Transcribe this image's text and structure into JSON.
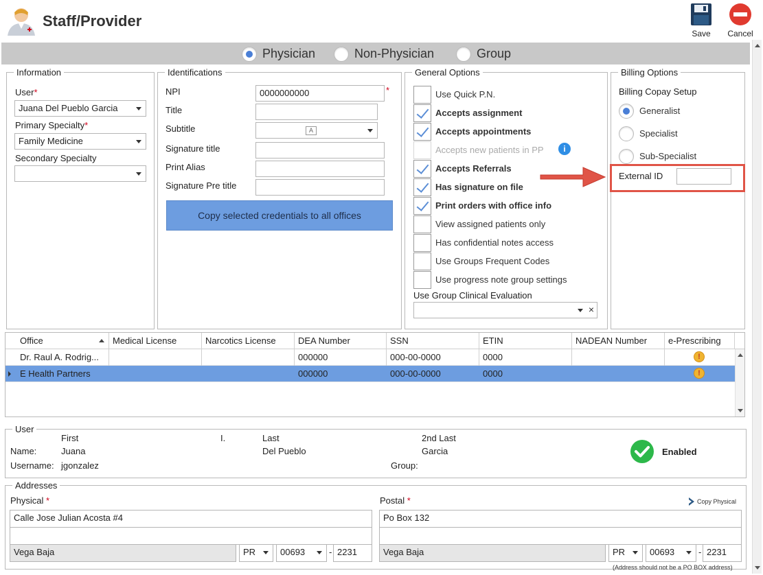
{
  "window": {
    "title": "Staff/Provider",
    "save_label": "Save",
    "cancel_label": "Cancel",
    "colors": {
      "accent": "#4a7fd6",
      "selected_row": "#6d9de0",
      "annotation": "#e05447",
      "enabled": "#2db84a"
    }
  },
  "provider_type": {
    "options": [
      "Physician",
      "Non-Physician",
      "Group"
    ],
    "selected": "Physician"
  },
  "information": {
    "legend": "Information",
    "user_label": "User",
    "user_value": "Juana Del Pueblo Garcia",
    "primary_specialty_label": "Primary Specialty",
    "primary_specialty_value": "Family Medicine",
    "secondary_specialty_label": "Secondary Specialty",
    "secondary_specialty_value": ""
  },
  "identifications": {
    "legend": "Identifications",
    "npi_label": "NPI",
    "npi_value": "0000000000",
    "title_label": "Title",
    "title_value": "",
    "subtitle_label": "Subtitle",
    "signature_title_label": "Signature title",
    "print_alias_label": "Print Alias",
    "signature_pre_title_label": "Signature Pre title",
    "copy_button": "Copy selected credentials to all offices"
  },
  "general_options": {
    "legend": "General Options",
    "items": [
      {
        "label": "Use Quick P.N.",
        "checked": false
      },
      {
        "label": "Accepts assignment",
        "checked": true
      },
      {
        "label": "Accepts appointments",
        "checked": true
      },
      {
        "label": "Accepts new patients in PP",
        "checked": false
      },
      {
        "label": "Accepts Referrals",
        "checked": true
      },
      {
        "label": "Has signature on file",
        "checked": true
      },
      {
        "label": "Print orders with office info",
        "checked": true
      },
      {
        "label": "View assigned patients only",
        "checked": false
      },
      {
        "label": "Has confidential notes access",
        "checked": false
      },
      {
        "label": "Use Groups Frequent Codes",
        "checked": false
      },
      {
        "label": "Use progress note group settings",
        "checked": false
      }
    ],
    "clinical_eval_label": "Use Group Clinical Evaluation",
    "clinical_eval_value": "",
    "clear_glyph": "×"
  },
  "billing_options": {
    "legend": "Billing Options",
    "copay_label": "Billing Copay Setup",
    "copay_options": [
      "Generalist",
      "Specialist",
      "Sub-Specialist"
    ],
    "copay_selected": "Generalist",
    "external_id_label": "External ID",
    "external_id_value": ""
  },
  "offices_grid": {
    "columns": [
      "Office",
      "Medical License",
      "Narcotics License",
      "DEA Number",
      "SSN",
      "ETIN",
      "NADEAN Number",
      "e-Prescribing"
    ],
    "rows": [
      {
        "office": "Dr. Raul A. Rodrig...",
        "medical_license": "",
        "narcotics_license": "",
        "dea": "000000",
        "ssn": "000-00-0000",
        "etin": "0000",
        "nadean": "",
        "eprescribing": "!",
        "selected": false
      },
      {
        "office": "E Health Partners",
        "medical_license": "",
        "narcotics_license": "",
        "dea": "000000",
        "ssn": "000-00-0000",
        "etin": "0000",
        "nadean": "",
        "eprescribing": "!",
        "selected": true
      }
    ]
  },
  "user": {
    "legend": "User",
    "first_header": "First",
    "initial_header": "I.",
    "last_header": "Last",
    "second_last_header": "2nd Last",
    "name_label": "Name:",
    "first": "Juana",
    "last": "Del Pueblo",
    "second_last": "Garcia",
    "username_label": "Username:",
    "username": "jgonzalez",
    "group_label": "Group:",
    "status": "Enabled"
  },
  "addresses": {
    "legend": "Addresses",
    "physical_label": "Physical",
    "postal_label": "Postal",
    "copy_physical": "Copy Physical",
    "physical": {
      "line1": "Calle Jose Julian Acosta #4",
      "line2": "",
      "city": "Vega Baja",
      "state": "PR",
      "zip": "00693",
      "zip4": "2231"
    },
    "postal": {
      "line1": "Po Box 132",
      "line2": "",
      "city": "Vega Baja",
      "state": "PR",
      "zip": "00693",
      "zip4": "2231"
    },
    "note": "(Address should not be a PO BOX address)"
  }
}
